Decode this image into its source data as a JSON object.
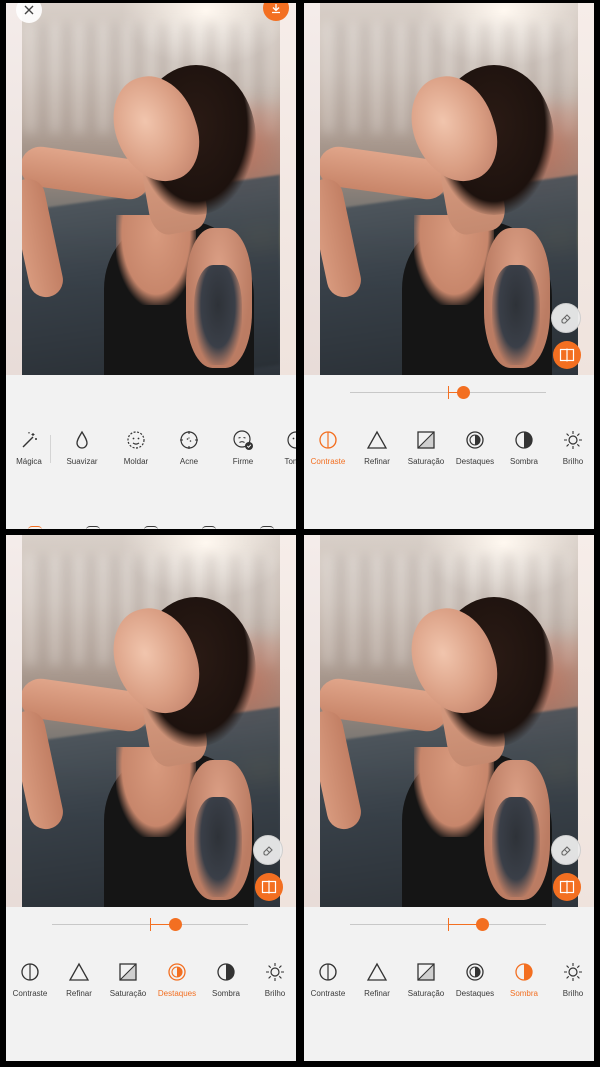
{
  "colors": {
    "accent": "#f36f21",
    "text": "#3a3a3a",
    "panel_bg": "#f2f2f2"
  },
  "panel1": {
    "tools": [
      {
        "label": "Mágica",
        "icon": "magic-wand-icon"
      },
      {
        "label": "Suavizar",
        "icon": "drop-icon"
      },
      {
        "label": "Moldar",
        "icon": "face-shape-icon"
      },
      {
        "label": "Acne",
        "icon": "acne-target-icon"
      },
      {
        "label": "Firme",
        "icon": "firm-face-icon"
      },
      {
        "label": "Tom D",
        "icon": "skin-tone-icon"
      }
    ]
  },
  "adjust_tools": [
    {
      "label": "Contraste",
      "icon": "contrast-icon"
    },
    {
      "label": "Refinar",
      "icon": "triangle-icon"
    },
    {
      "label": "Saturação",
      "icon": "saturation-icon"
    },
    {
      "label": "Destaques",
      "icon": "highlights-icon"
    },
    {
      "label": "Sombra",
      "icon": "shadow-icon"
    },
    {
      "label": "Brilho",
      "icon": "sun-icon"
    }
  ],
  "panel2": {
    "active": "Contraste",
    "slider_value": 0.15
  },
  "panel3": {
    "active": "Destaques",
    "slider_value": 0.25
  },
  "panel4": {
    "active": "Sombra",
    "slider_value": 0.35
  }
}
